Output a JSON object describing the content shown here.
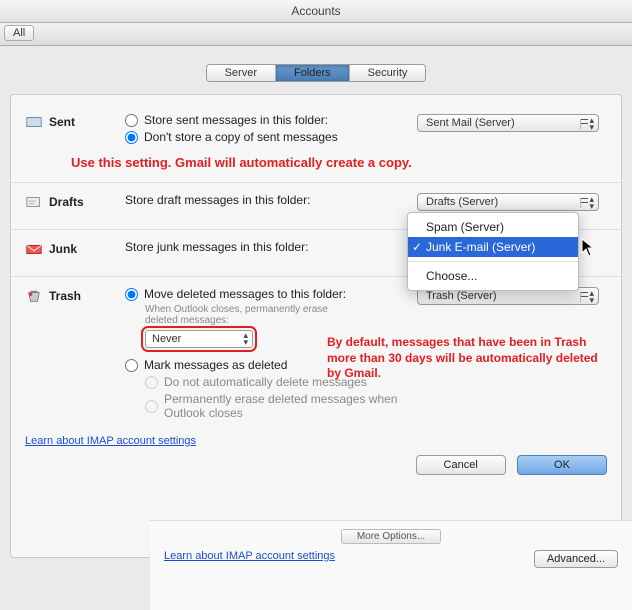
{
  "window": {
    "title": "Accounts"
  },
  "toolbar": {
    "all_label": "All"
  },
  "tabs": {
    "server": "Server",
    "folders": "Folders",
    "security": "Security"
  },
  "sent": {
    "label": "Sent",
    "opt_store": "Store sent messages in this folder:",
    "opt_nostore": "Don't store a copy of sent messages",
    "folder": "Sent Mail (Server)"
  },
  "note_sent": "Use this setting. Gmail will automatically create a copy.",
  "drafts": {
    "label": "Drafts",
    "text": "Store draft messages in this folder:",
    "folder": "Drafts (Server)"
  },
  "junk": {
    "label": "Junk",
    "text": "Store junk messages in this folder:",
    "menu": {
      "spam": "Spam (Server)",
      "junk": "Junk E-mail (Server)",
      "choose": "Choose..."
    }
  },
  "trash": {
    "label": "Trash",
    "opt_move": "Move deleted messages to this folder:",
    "hint": "When Outlook closes, permanently erase deleted messages:",
    "never": "Never",
    "opt_mark": "Mark messages as deleted",
    "sub1": "Do not automatically delete messages",
    "sub2": "Permanently erase deleted messages when Outlook closes",
    "folder": "Trash (Server)"
  },
  "note_trash": "By default, messages that have been in Trash more than 30 days will be automatically deleted by Gmail.",
  "link_imap": "Learn about IMAP account settings",
  "buttons": {
    "cancel": "Cancel",
    "ok": "OK"
  },
  "bg": {
    "more": "More Options...",
    "link": "Learn about IMAP account settings",
    "advanced": "Advanced..."
  }
}
